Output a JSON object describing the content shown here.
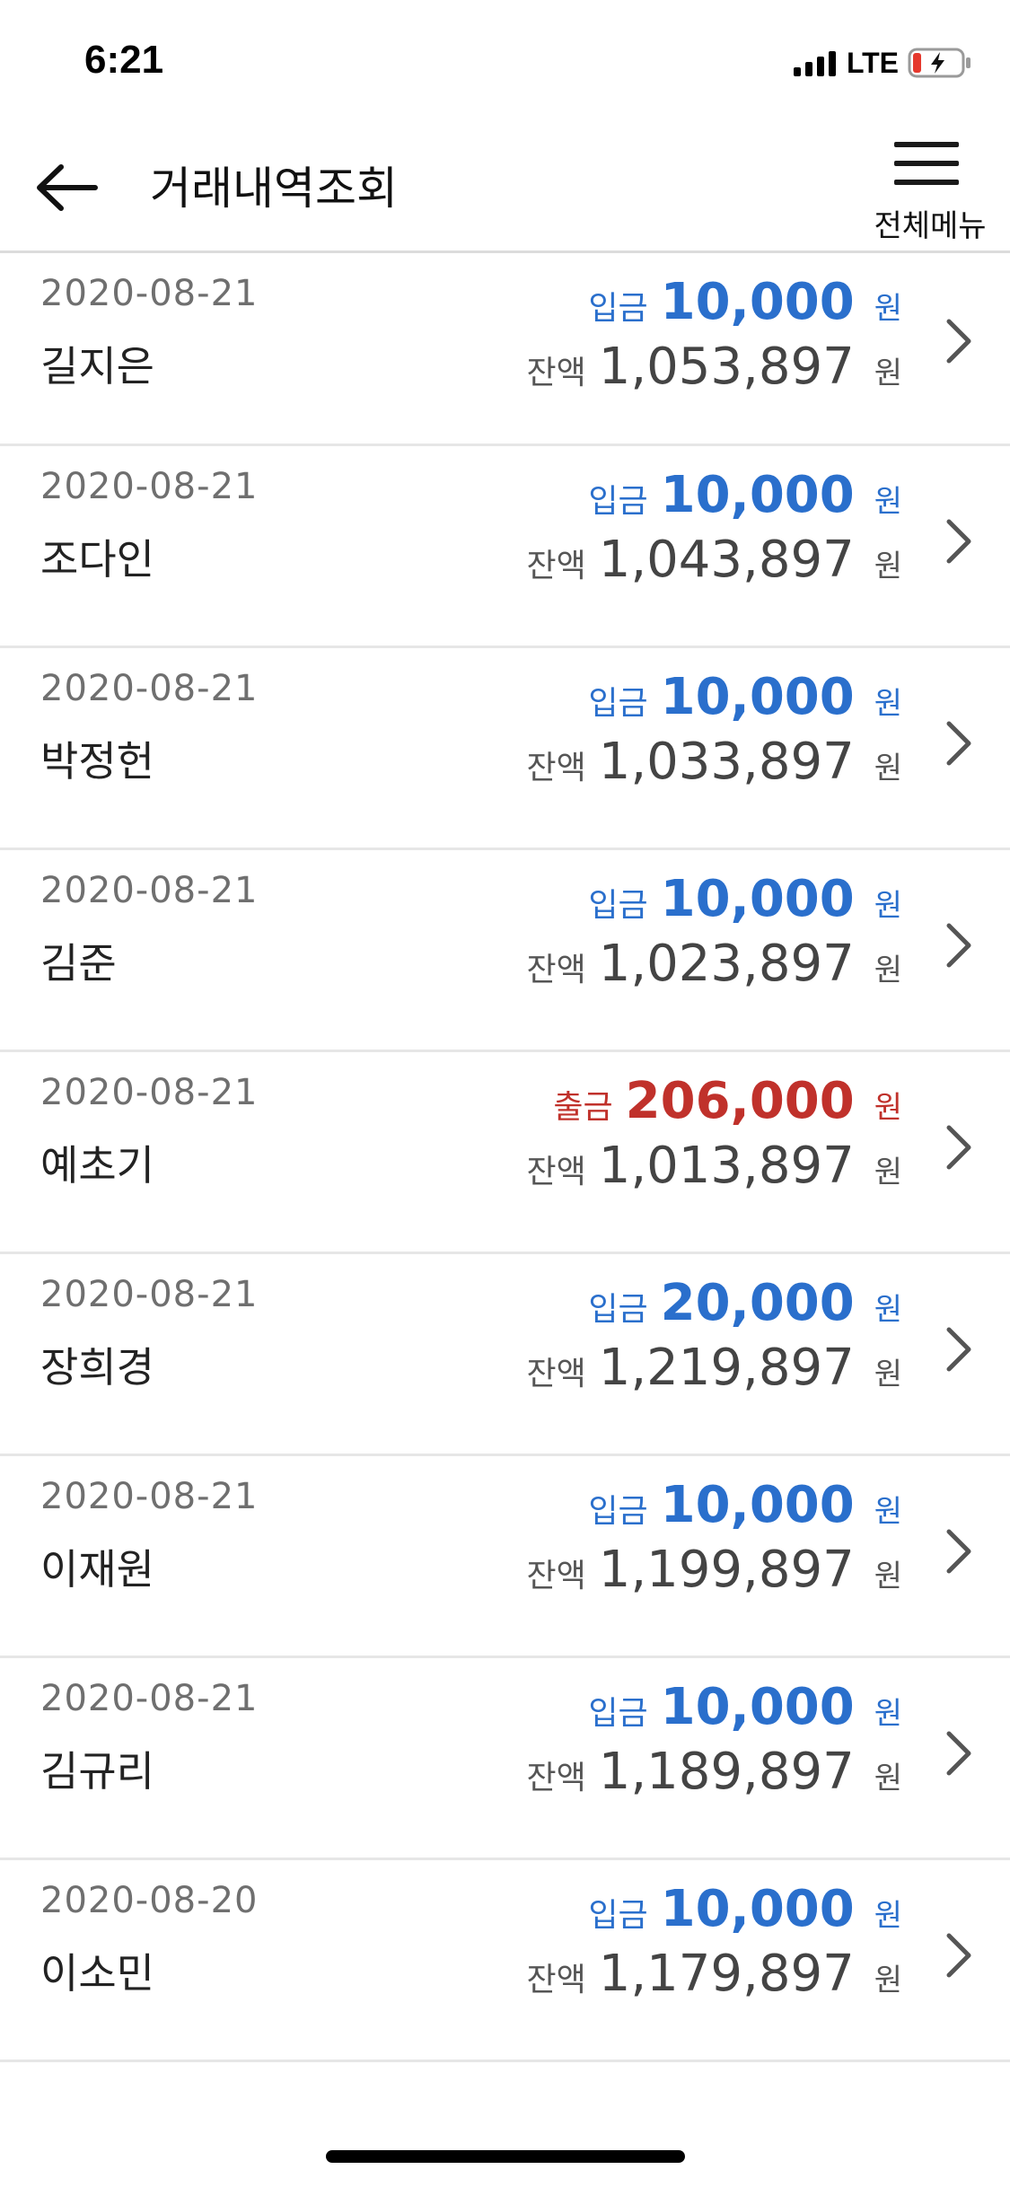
{
  "status_bar": {
    "time": "6:21",
    "network": "LTE"
  },
  "header": {
    "title": "거래내역조회",
    "menu_label": "전체메뉴"
  },
  "colors": {
    "deposit": "#2a6fcc",
    "withdrawal": "#c0312b"
  },
  "transactions": [
    {
      "date": "2020-08-21",
      "name": "길지은",
      "type": "입금",
      "amount": "10,000",
      "unit": "원",
      "balance_label": "잔액",
      "balance": "1,053,897",
      "balance_unit": "원",
      "kind": "deposit"
    },
    {
      "date": "2020-08-21",
      "name": "조다인",
      "type": "입금",
      "amount": "10,000",
      "unit": "원",
      "balance_label": "잔액",
      "balance": "1,043,897",
      "balance_unit": "원",
      "kind": "deposit"
    },
    {
      "date": "2020-08-21",
      "name": "박정헌",
      "type": "입금",
      "amount": "10,000",
      "unit": "원",
      "balance_label": "잔액",
      "balance": "1,033,897",
      "balance_unit": "원",
      "kind": "deposit"
    },
    {
      "date": "2020-08-21",
      "name": "김준",
      "type": "입금",
      "amount": "10,000",
      "unit": "원",
      "balance_label": "잔액",
      "balance": "1,023,897",
      "balance_unit": "원",
      "kind": "deposit"
    },
    {
      "date": "2020-08-21",
      "name": "예초기",
      "type": "출금",
      "amount": "206,000",
      "unit": "원",
      "balance_label": "잔액",
      "balance": "1,013,897",
      "balance_unit": "원",
      "kind": "withdrawal"
    },
    {
      "date": "2020-08-21",
      "name": "장희경",
      "type": "입금",
      "amount": "20,000",
      "unit": "원",
      "balance_label": "잔액",
      "balance": "1,219,897",
      "balance_unit": "원",
      "kind": "deposit"
    },
    {
      "date": "2020-08-21",
      "name": "이재원",
      "type": "입금",
      "amount": "10,000",
      "unit": "원",
      "balance_label": "잔액",
      "balance": "1,199,897",
      "balance_unit": "원",
      "kind": "deposit"
    },
    {
      "date": "2020-08-21",
      "name": "김규리",
      "type": "입금",
      "amount": "10,000",
      "unit": "원",
      "balance_label": "잔액",
      "balance": "1,189,897",
      "balance_unit": "원",
      "kind": "deposit"
    },
    {
      "date": "2020-08-20",
      "name": "이소민",
      "type": "입금",
      "amount": "10,000",
      "unit": "원",
      "balance_label": "잔액",
      "balance": "1,179,897",
      "balance_unit": "원",
      "kind": "deposit"
    }
  ]
}
